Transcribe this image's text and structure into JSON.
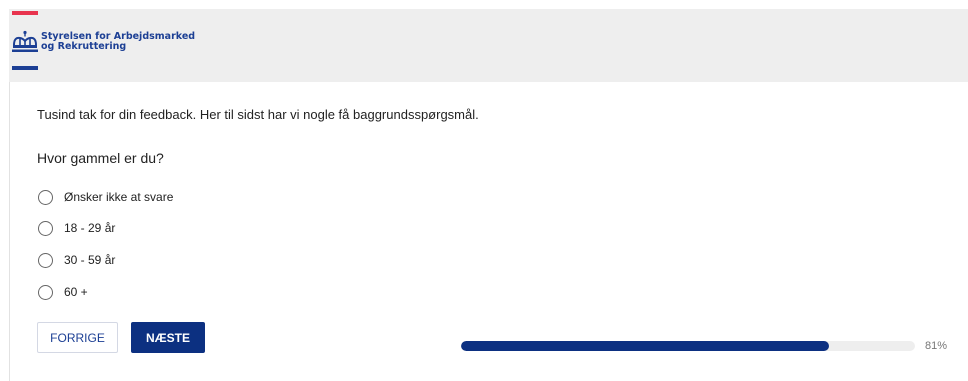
{
  "header": {
    "org_line1": "Styrelsen for Arbejdsmarked",
    "org_line2": "og Rekruttering",
    "crown_icon": "crown-icon",
    "colors": {
      "red": "#e8344e",
      "blue": "#1c3f94"
    }
  },
  "survey": {
    "intro": "Tusind tak for din feedback. Her til sidst har vi nogle få baggrundsspørgsmål.",
    "question": "Hvor gammel er du?",
    "options": [
      {
        "label": "Ønsker ikke at svare",
        "selected": false
      },
      {
        "label": "18 - 29 år",
        "selected": false
      },
      {
        "label": "30 - 59 år",
        "selected": false
      },
      {
        "label": "60 +",
        "selected": false
      }
    ]
  },
  "nav": {
    "prev_label": "FORRIGE",
    "next_label": "NÆSTE"
  },
  "progress": {
    "percent": 81,
    "label": "81%",
    "fill_color": "#0c3081"
  }
}
